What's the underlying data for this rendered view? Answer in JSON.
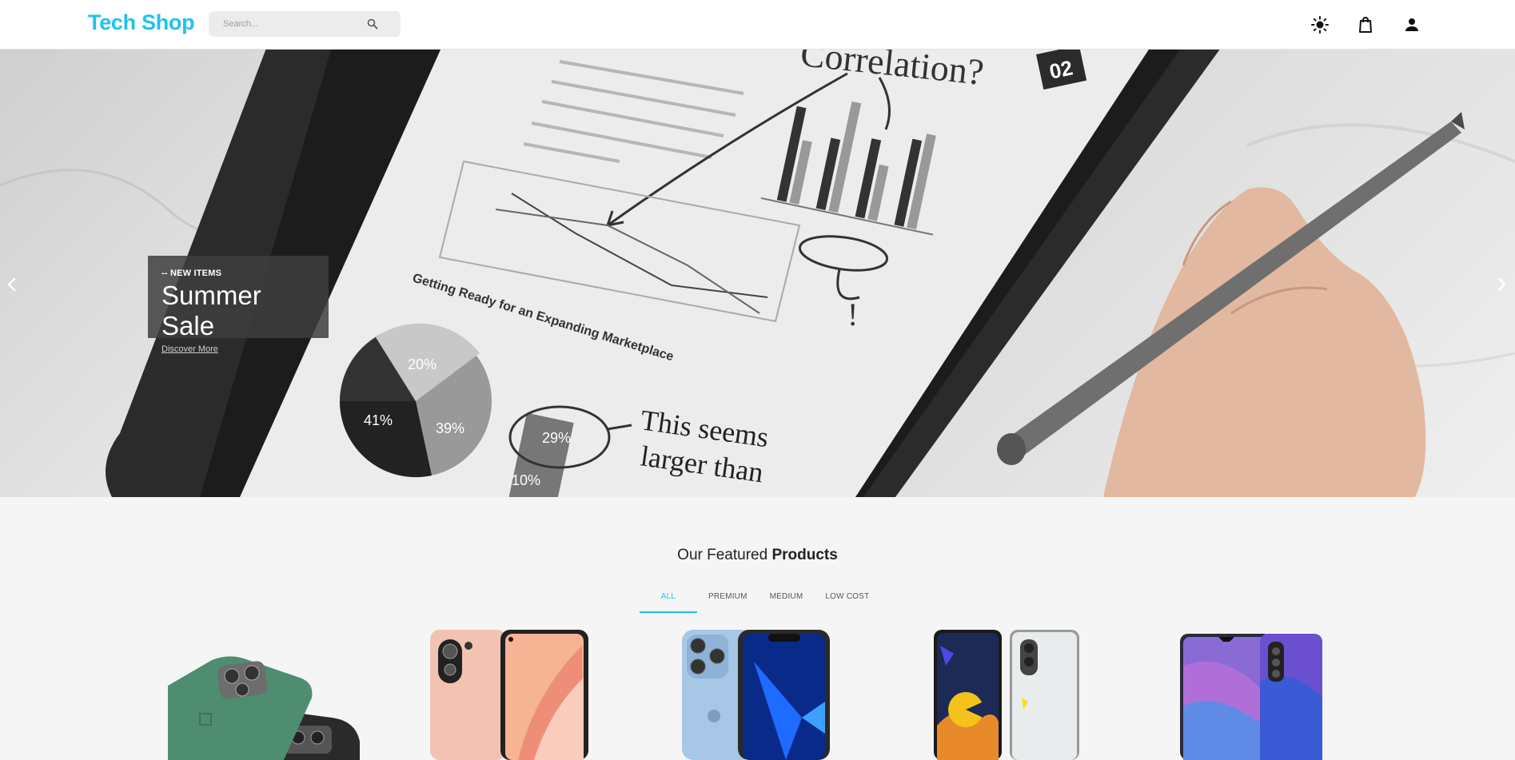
{
  "header": {
    "logo": "Tech Shop",
    "search_placeholder": "Search..."
  },
  "icons": {
    "search": "search-icon",
    "theme": "sun-icon",
    "cart": "shopping-bag-icon",
    "account": "user-icon",
    "prev": "chevron-left-icon",
    "next": "chevron-right-icon"
  },
  "hero": {
    "kicker": "-- NEW ITEMS",
    "title": "Summer Sale",
    "cta": "Discover More"
  },
  "featured": {
    "title_prefix": "Our Featured",
    "title_bold": "Products",
    "tabs": [
      "ALL",
      "PREMIUM",
      "MEDIUM",
      "LOW COST"
    ],
    "active_tab": "ALL"
  },
  "colors": {
    "accent": "#1ec3ea",
    "background": "#f5f5f5",
    "header_bg": "#ffffff"
  }
}
